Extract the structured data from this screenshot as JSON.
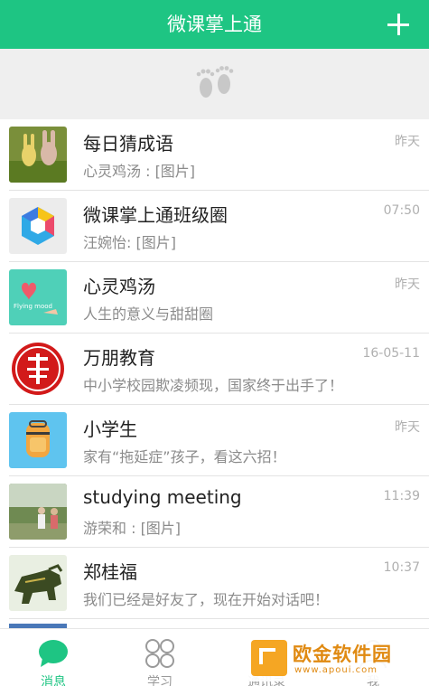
{
  "header": {
    "title": "微课掌上通",
    "add_icon": "plus-icon"
  },
  "pulldown": {
    "icon": "footprints-icon"
  },
  "conversations": [
    {
      "name": "每日猜成语",
      "preview": "心灵鸡汤 : [图片]",
      "time": "昨天",
      "avatar": "rabbit-photo"
    },
    {
      "name": "微课掌上通班级圈",
      "preview": "汪婉怡: [图片]",
      "time": "07:50",
      "avatar": "hexagon-logo"
    },
    {
      "name": "心灵鸡汤",
      "preview": "人生的意义与甜甜圈",
      "time": "昨天",
      "avatar": "heart-flying-mood",
      "avatar_text": "Flying mood"
    },
    {
      "name": "万朋教育",
      "preview": "中小学校园欺凌频现，国家终于出手了！",
      "time": "16-05-11",
      "avatar": "wanpeng-seal"
    },
    {
      "name": "小学生",
      "preview": "家有“拖延症”孩子，看这六招！",
      "time": "昨天",
      "avatar": "schoolbag-icon"
    },
    {
      "name": "studying meeting",
      "preview": "游荣和 : [图片]",
      "time": "11:39",
      "avatar": "people-photo"
    },
    {
      "name": "郑桂福",
      "preview": "我们已经是好友了，现在开始对话吧！",
      "time": "10:37",
      "avatar": "animal-photo"
    }
  ],
  "tabs": [
    {
      "label": "消息",
      "icon": "chat-bubble-icon",
      "active": true
    },
    {
      "label": "学习",
      "icon": "grid-icon",
      "active": false
    },
    {
      "label": "通讯录",
      "icon": "contacts-icon",
      "active": false
    },
    {
      "label": "我",
      "icon": "person-icon",
      "active": false
    }
  ],
  "watermark": {
    "text": "欧金软件园",
    "url": "www.apoui.com"
  },
  "colors": {
    "accent": "#1ec583",
    "background": "#efefef"
  }
}
